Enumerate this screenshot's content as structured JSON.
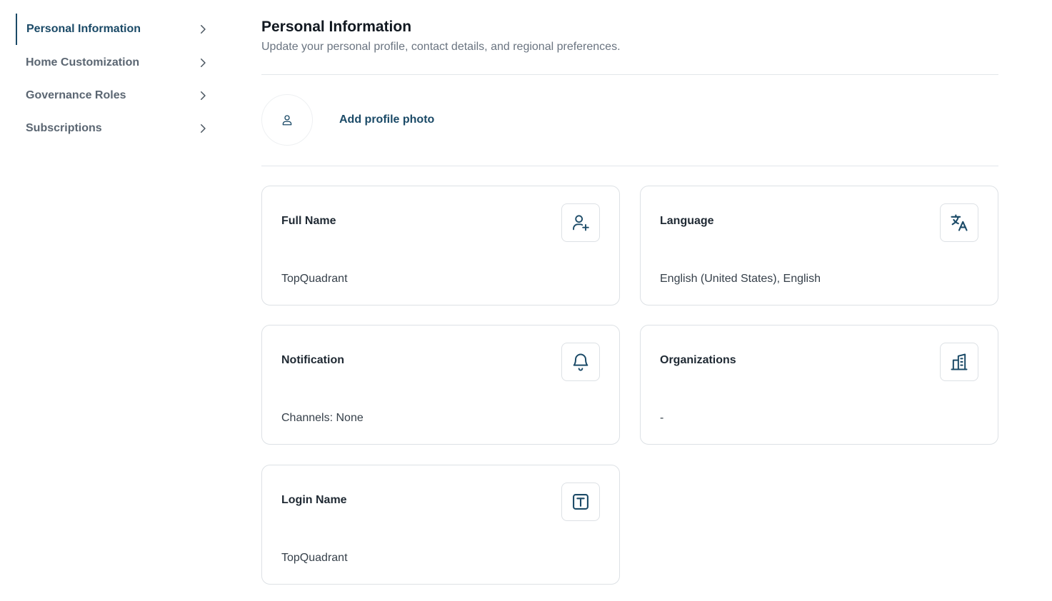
{
  "sidebar": {
    "items": [
      {
        "label": "Personal Information",
        "active": true
      },
      {
        "label": "Home Customization",
        "active": false
      },
      {
        "label": "Governance Roles",
        "active": false
      },
      {
        "label": "Subscriptions",
        "active": false
      }
    ]
  },
  "header": {
    "title": "Personal Information",
    "subtitle": "Update your personal profile, contact details, and regional preferences."
  },
  "profile": {
    "add_photo_label": "Add profile photo",
    "avatar_icon": "user-icon"
  },
  "cards": [
    {
      "label": "Full Name",
      "value": "TopQuadrant",
      "icon": "user-plus-icon"
    },
    {
      "label": "Language",
      "value": "English (United States), English",
      "icon": "translate-icon"
    },
    {
      "label": "Notification",
      "value": "Channels: None",
      "icon": "bell-icon"
    },
    {
      "label": "Organizations",
      "value": "-",
      "icon": "building-icon"
    },
    {
      "label": "Login Name",
      "value": "TopQuadrant",
      "icon": "text-box-icon"
    }
  ],
  "colors": {
    "accent": "#1b4a67",
    "border": "#dde1e5",
    "muted_text": "#5b6672"
  }
}
